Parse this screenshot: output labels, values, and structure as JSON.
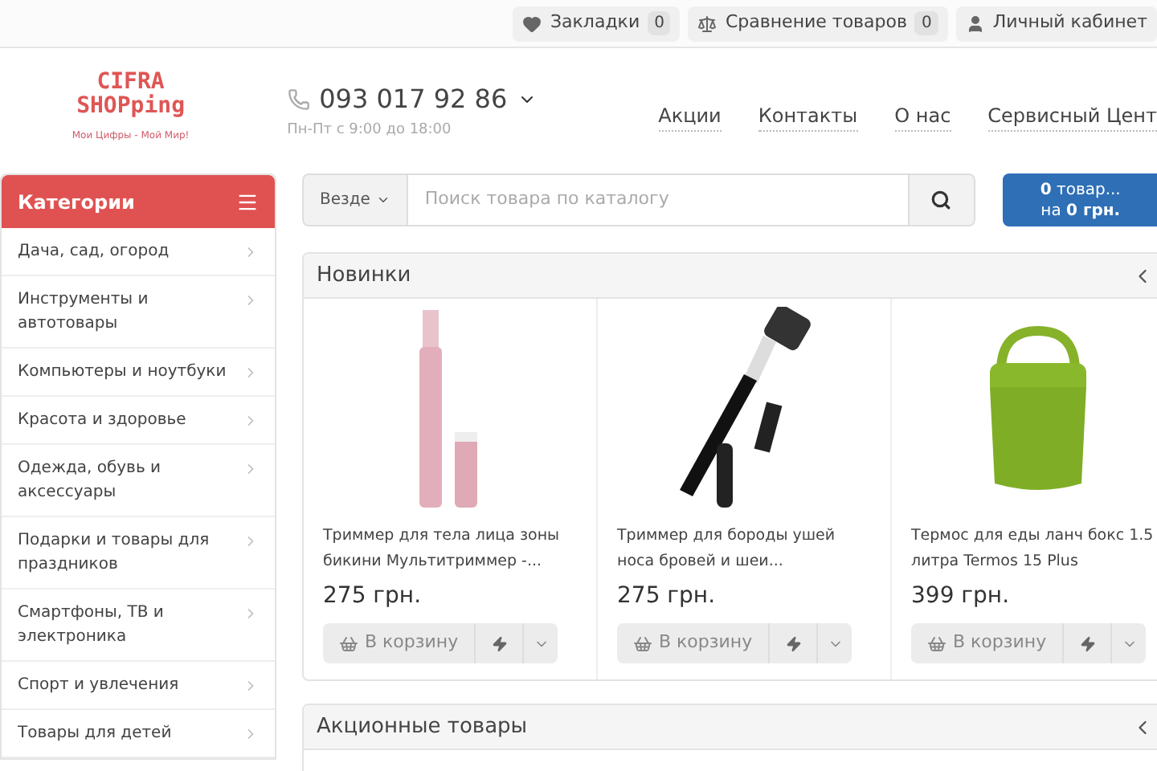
{
  "top_bar": [
    {
      "kind": "bookmarks",
      "label": "Закладки",
      "count": "0"
    },
    {
      "kind": "compare",
      "label": "Сравнение товаров",
      "count": "0"
    },
    {
      "kind": "account",
      "label": "Личный кабинет"
    }
  ],
  "logo": {
    "line_1": "CIFRA",
    "line_2": "SHOPping",
    "tagline": "Мои Цифры - Мой Мир!"
  },
  "phone": {
    "number": "093 017 92 86",
    "hours": "Пн-Пт с 9:00 до 18:00"
  },
  "nav": [
    "Акции",
    "Контакты",
    "О нас",
    "Сервисный Цент"
  ],
  "categories": {
    "title": "Категории",
    "items": [
      "Дача, сад, огород",
      "Инструменты и автотовары",
      "Компьютеры и ноутбуки",
      "Красота и здоровье",
      "Одежда, обувь и аксессуары",
      "Подарки и товары для праздников",
      "Смартфоны, ТВ и электроника",
      "Спорт и увлечения",
      "Товары для детей"
    ]
  },
  "search": {
    "scope": "Везде",
    "placeholder": "Поиск товара по каталогу"
  },
  "cart": {
    "line_1_bold": "0",
    "line_1": "товар...",
    "line_2": "на",
    "line_2_bold": "0 грн."
  },
  "new_products": {
    "title": "Новинки",
    "products": [
      {
        "kind": "pink-trimmer",
        "name": "Триммер для тела лица зоны бикини Мультитриммер -...",
        "price": "275 грн.",
        "button": "В корзину"
      },
      {
        "kind": "black-trimmer",
        "name": "Триммер для бороды ушей носа бровей и шеи...",
        "price": "275 грн.",
        "button": "В корзину"
      },
      {
        "kind": "green-thermos",
        "name": "Термос для еды ланч бокс 1.5 литра Termos 15 Plus",
        "price": "399 грн.",
        "button": "В корзину"
      }
    ]
  },
  "sale_products": {
    "title": "Акционные товары"
  }
}
